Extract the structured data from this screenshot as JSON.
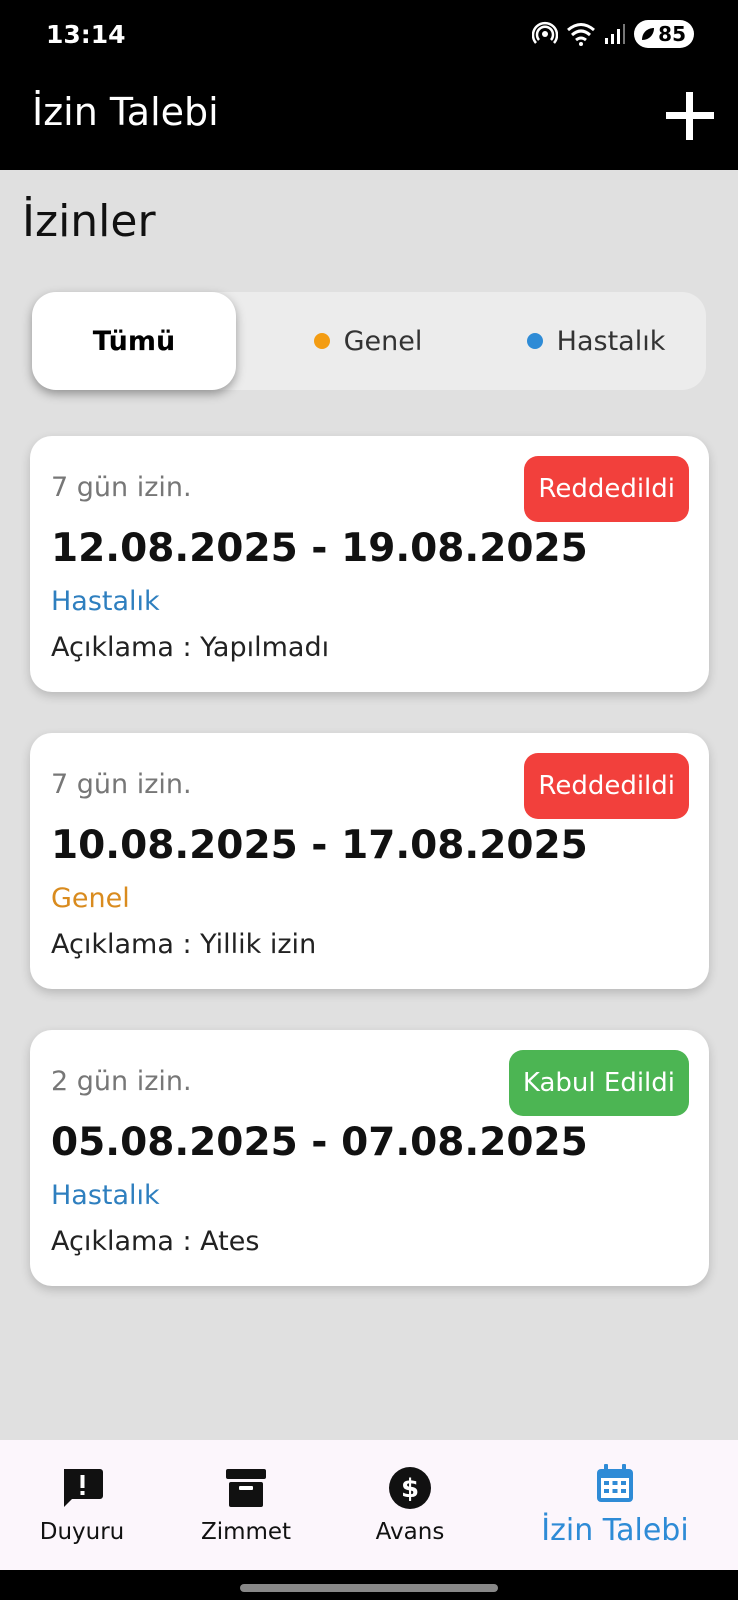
{
  "status_bar": {
    "time": "13:14",
    "battery": "85"
  },
  "app_bar": {
    "title": "İzin Talebi"
  },
  "heading": "İzinler",
  "filters": [
    {
      "label": "Tümü",
      "dot_color": ""
    },
    {
      "label": "Genel",
      "dot_color": "#f39c12"
    },
    {
      "label": "Hastalık",
      "dot_color": "#2e8bd6"
    }
  ],
  "cards": [
    {
      "days": "7 gün izin.",
      "dates": "12.08.2025 - 19.08.2025",
      "type": "Hastalık",
      "type_color": "#2e7fbf",
      "description": "Açıklama : Yapılmadı",
      "status": "Reddedildi",
      "status_color": "#f2403c"
    },
    {
      "days": "7 gün izin.",
      "dates": "10.08.2025 - 17.08.2025",
      "type": "Genel",
      "type_color": "#d98b1e",
      "description": "Açıklama : Yillik izin",
      "status": "Reddedildi",
      "status_color": "#f2403c"
    },
    {
      "days": "2 gün izin.",
      "dates": "05.08.2025 - 07.08.2025",
      "type": "Hastalık",
      "type_color": "#2e7fbf",
      "description": "Açıklama : Ates",
      "status": "Kabul Edildi",
      "status_color": "#4cb553"
    }
  ],
  "nav": [
    {
      "label": "Duyuru",
      "icon": "announcement-icon"
    },
    {
      "label": "Zimmet",
      "icon": "archive-icon"
    },
    {
      "label": "Avans",
      "icon": "dollar-icon"
    },
    {
      "label": "İzin Talebi",
      "icon": "calendar-icon"
    }
  ],
  "colors": {
    "accent": "#2e8bd6",
    "app_bar": "#000000",
    "background": "#e0e0e0"
  }
}
